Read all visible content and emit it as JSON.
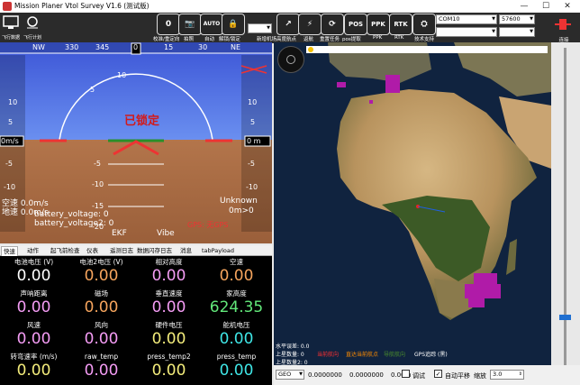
{
  "window": {
    "title": "Mission Planer Vtol Survey V1.6 (测试版)",
    "min_glyph": "—",
    "max_glyph": "☐",
    "close_glyph": "✕"
  },
  "left_nav": {
    "flight_data": "飞行数据",
    "flight_plan": "飞行计划"
  },
  "toolbar": {
    "buttons": [
      {
        "glyph": "0",
        "label": "校准/重定向"
      },
      {
        "glyph": "📷",
        "label": "拍照"
      },
      {
        "glyph": "AUTO",
        "label": "自动"
      },
      {
        "glyph": "🔒",
        "label": "解锁/锁定"
      },
      {
        "glyph": "↗",
        "label": "新增机场高度航点"
      },
      {
        "glyph": "⚡",
        "label": "返航"
      },
      {
        "glyph": "⟳",
        "label": "重置任务"
      },
      {
        "glyph": "POS",
        "label": "pos提取"
      },
      {
        "glyph": "PPK",
        "label": "PPK"
      },
      {
        "glyph": "RTK",
        "label": "RTK"
      },
      {
        "glyph": "⛭",
        "label": "技术支持"
      }
    ],
    "small_combo_value": "",
    "com_port": "COM10",
    "baud": "57600",
    "connect_label": "连接"
  },
  "hud": {
    "heading_ticks": [
      "NW",
      "330",
      "345",
      "0",
      "15",
      "30",
      "NE"
    ],
    "heading_value": "0",
    "pitch_ticks": [
      "10",
      "5",
      "0",
      "-5",
      "-10",
      "-15",
      "-20"
    ],
    "alt_ticks": [
      "10",
      "5",
      "0",
      "-5",
      "-10"
    ],
    "speed_readout": "0m/s",
    "alt_readout": "0 m",
    "armed_status": "已锁定",
    "airspeed": "空速 0.0m/s",
    "groundspeed": "地速 0.0m/s",
    "battery1": "battery_voltage: 0",
    "battery2": "battery_voltage2: 0",
    "mode": "Unknown",
    "dist": "0m>0",
    "ekf": "EKF",
    "vibe": "Vibe",
    "gps": "GPS: 无GPS"
  },
  "tabs": [
    "快速",
    "动作",
    "起飞前检查",
    "仪表",
    "遥测日志",
    "数据闪存日志",
    "消息",
    "tabPayload"
  ],
  "status": {
    "colors": {
      "white": "#ffffff",
      "orange": "#f5a45d",
      "purple": "#f49cf4",
      "green": "#62e87a",
      "yellow": "#f3ec7b",
      "cyan": "#3fe6e6",
      "lightgreen": "#7df07d"
    },
    "cells": [
      {
        "label": "电池电压 (V)",
        "value": "0.00",
        "color": "#ffffff"
      },
      {
        "label": "电池2电压 (V)",
        "value": "0.00",
        "color": "#f5a45d"
      },
      {
        "label": "相对高度",
        "value": "0.00",
        "color": "#f49cf4"
      },
      {
        "label": "空速",
        "value": "0.00",
        "color": "#f5a45d"
      },
      {
        "label": "声呐距离",
        "value": "0.00",
        "color": "#f49cf4"
      },
      {
        "label": "磁场",
        "value": "0.00",
        "color": "#f5a45d"
      },
      {
        "label": "垂直速度",
        "value": "0.00",
        "color": "#f49cf4"
      },
      {
        "label": "家高度",
        "value": "624.35",
        "color": "#62e87a"
      },
      {
        "label": "风速",
        "value": "0.00",
        "color": "#f49cf4"
      },
      {
        "label": "风向",
        "value": "0.00",
        "color": "#f49cf4"
      },
      {
        "label": "硬件电压",
        "value": "0.00",
        "color": "#f3ec7b"
      },
      {
        "label": "舵机电压",
        "value": "0.00",
        "color": "#3fe6e6"
      },
      {
        "label": "转弯速率 (m/s)",
        "value": "0.00",
        "color": "#f3ec7b"
      },
      {
        "label": "raw_temp",
        "value": "0.00",
        "color": "#f49cf4"
      },
      {
        "label": "press_temp2",
        "value": "0.00",
        "color": "#f3ec7b"
      },
      {
        "label": "press_temp",
        "value": "0.00",
        "color": "#3fe6e6"
      }
    ]
  },
  "map": {
    "horiz_error": "水平误差: 0.0",
    "up_angle": "上星数量: 0",
    "up_angle2": "上星数量2: 0",
    "legend_current": "当前航向",
    "legend_target": "直达当前航点",
    "legend_nav": "导航航向",
    "legend_gps": "GPS追踪 (黑)",
    "legend_colors": {
      "current": "#ff3030",
      "target": "#ff8c00",
      "nav": "#4c8f2c",
      "gps": "#ffffff"
    }
  },
  "bottom": {
    "coord_system": "GEO",
    "lat": "0.0000000",
    "lng": "0.0000000",
    "alt": "0.00m",
    "debug_label": "调试",
    "auto_pan_label": "自动平移",
    "zoom_label": "缩放",
    "zoom_value": "3.0"
  }
}
